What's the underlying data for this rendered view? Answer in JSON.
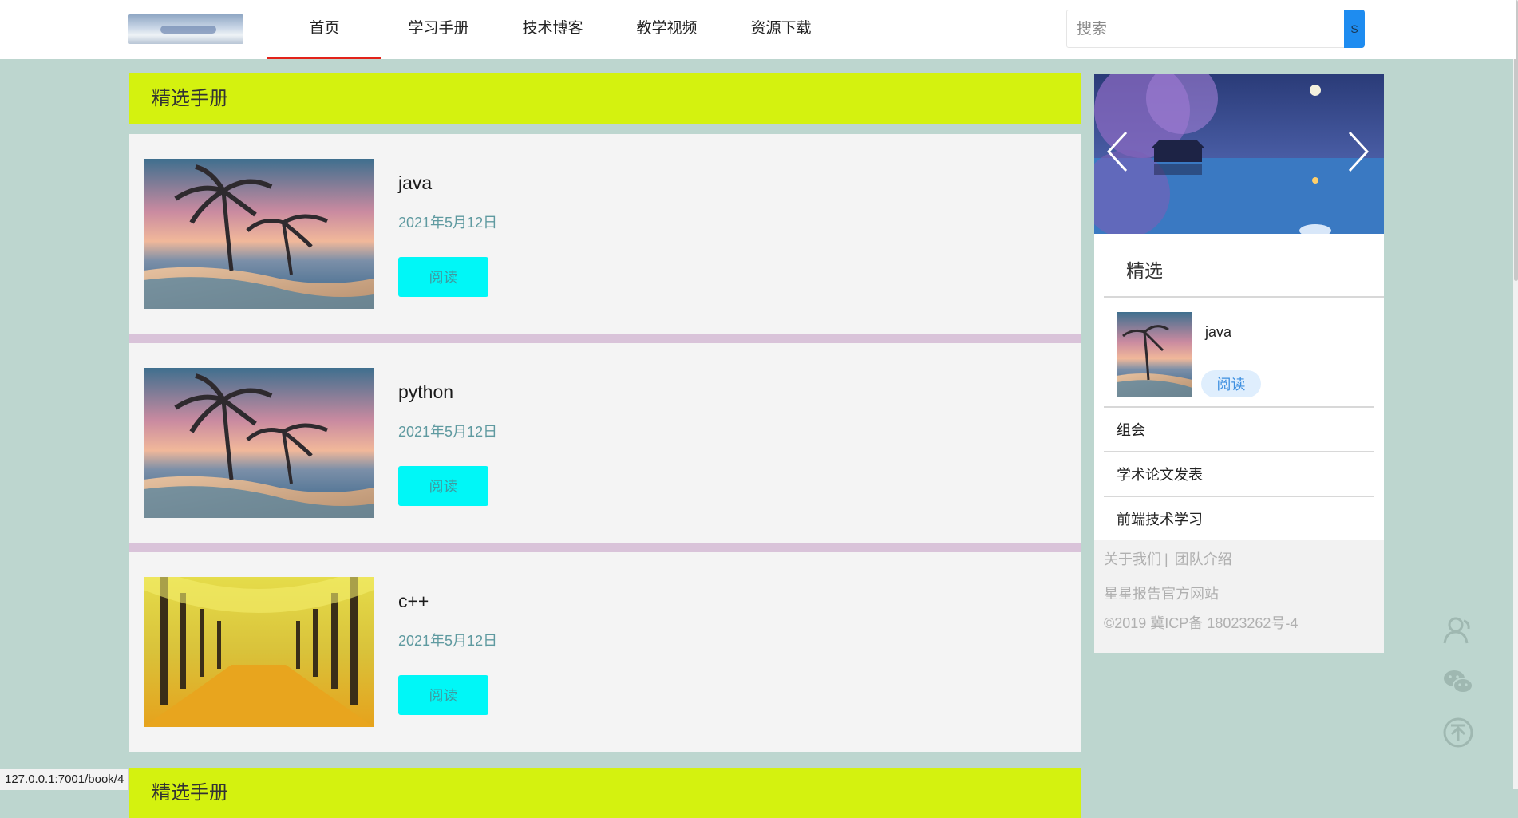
{
  "header": {
    "logo_icon": "logo-image",
    "nav": [
      {
        "label": "首页",
        "active": true
      },
      {
        "label": "学习手册",
        "active": false
      },
      {
        "label": "技术博客",
        "active": false
      },
      {
        "label": "教学视频",
        "active": false
      },
      {
        "label": "资源下载",
        "active": false
      }
    ],
    "search": {
      "placeholder": "搜索",
      "button_label": "S"
    }
  },
  "main": {
    "section_title": "精选手册",
    "cards": [
      {
        "title": "java",
        "date": "2021年5月12日",
        "button": "阅读",
        "image": "palm-beach-sunset"
      },
      {
        "title": "python",
        "date": "2021年5月12日",
        "button": "阅读",
        "image": "palm-beach-sunset"
      },
      {
        "title": "c++",
        "date": "2021年5月12日",
        "button": "阅读",
        "image": "golden-tree-avenue"
      }
    ],
    "next_section_title": "精选手册"
  },
  "sidebar": {
    "carousel_image": "night-lake-palace",
    "panel_title": "精选",
    "featured": {
      "title": "java",
      "button": "阅读",
      "image": "palm-beach-sunset"
    },
    "links": [
      "组会",
      "学术论文发表",
      "前端技术学习"
    ],
    "footer": {
      "about": "关于我们",
      "separator": "|",
      "team": "团队介绍",
      "site": "星星报告官方网站",
      "icp": "©2019 冀ICP备 18023262号-4"
    }
  },
  "floating_icons": [
    "contact-icon",
    "wechat-icon",
    "back-to-top-icon"
  ],
  "status_url": "127.0.0.1:7001/book/4",
  "colors": {
    "page_bg": "#bdd6cf",
    "section_head": "#d4f20f",
    "read_button": "#00f7f7",
    "card_divider": "#d9c3d9",
    "nav_active_underline": "#e2231a",
    "search_button": "#1e8cf0"
  }
}
